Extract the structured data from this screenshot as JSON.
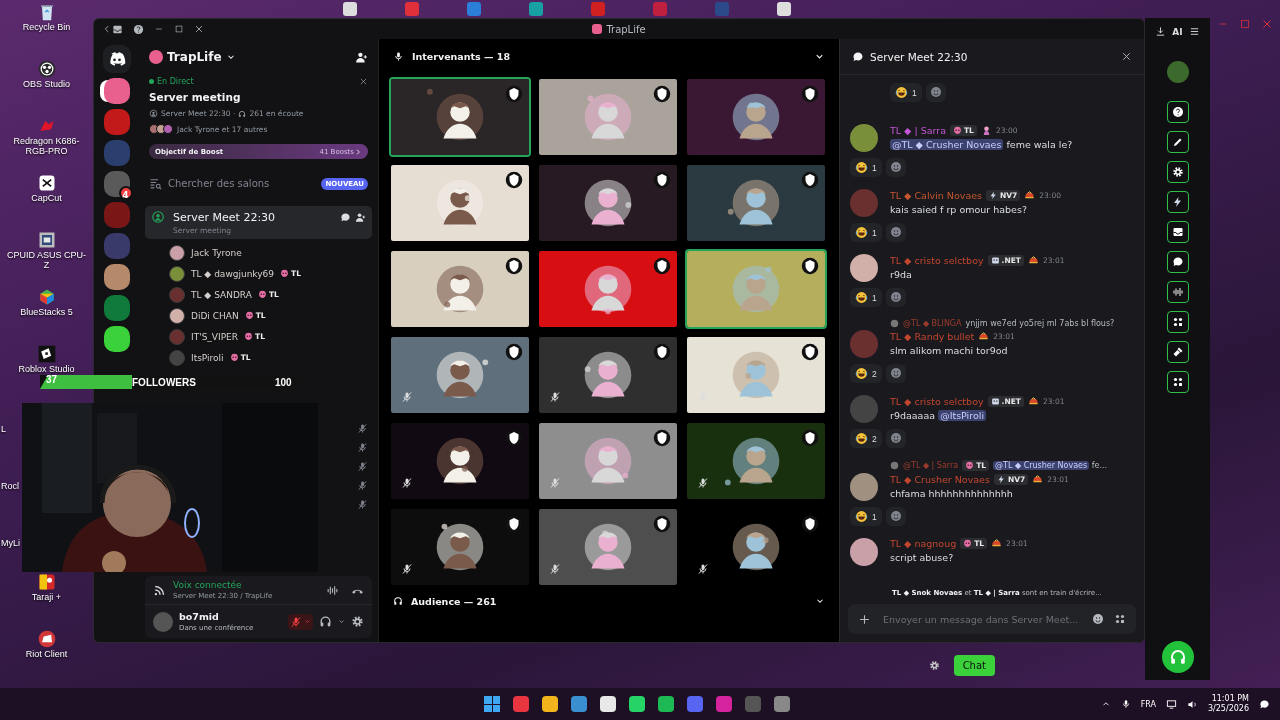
{
  "desktop_icons": [
    {
      "kind": "bin",
      "label": "Recycle Bin"
    },
    {
      "kind": "obs",
      "label": "OBS Studio"
    },
    {
      "kind": "redragon",
      "label": "Redragon K686-RGB-PRO"
    },
    {
      "kind": "capcut",
      "label": "CapCut"
    },
    {
      "kind": "cpuz",
      "label": "CPUID ASUS CPU-Z"
    },
    {
      "kind": "bluestacks",
      "label": "BlueStacks 5"
    },
    {
      "kind": "roblox",
      "label": "Roblox Studio"
    },
    {
      "kind": "hidden",
      "label": "L"
    },
    {
      "kind": "hidden",
      "label": "Rocl"
    },
    {
      "kind": "hidden",
      "label": "MyLi"
    },
    {
      "kind": "taraji",
      "label": "Taraji +"
    },
    {
      "kind": "riot",
      "label": "Riot Client"
    }
  ],
  "window": {
    "title": "TrapLife"
  },
  "servers": [
    {
      "color": "#e9608f",
      "selected": true
    },
    {
      "color": "#c21a1a",
      "selected": false
    },
    {
      "color": "#2b3f6e",
      "selected": false
    },
    {
      "color": "#5a5a5a",
      "selected": false,
      "badge": "4"
    },
    {
      "color": "#7a1616",
      "selected": false
    },
    {
      "color": "#3a3a6a",
      "selected": false
    },
    {
      "color": "#b58a6a",
      "selected": false
    },
    {
      "color": "#0f7a3a",
      "selected": false
    },
    {
      "color": "#3ad13a",
      "selected": false
    }
  ],
  "server": {
    "name": "TrapLife"
  },
  "event": {
    "status": "En Direct",
    "title": "Server meeting",
    "channel": "Server Meet 22:30 ·",
    "listeners": "261 en écoute",
    "attendees": "Jack Tyrone et 17 autres"
  },
  "boost": {
    "label": "Objectif de Boost",
    "count": "41 Boosts"
  },
  "channel_search": {
    "placeholder": "Chercher des salons",
    "badge": "NOUVEAU"
  },
  "voice_channel": {
    "name": "Server Meet 22:30",
    "topic": "Server meeting",
    "selected": true
  },
  "members": [
    {
      "name": "Jack Tyrone"
    },
    {
      "name": "TL ◆ dawgjunky69",
      "tag": "TL"
    },
    {
      "name": "TL ◆ SANDRA",
      "tag": "TL"
    },
    {
      "name": "DiDi CHAN",
      "tag": "TL"
    },
    {
      "name": "IT'S_VIPER",
      "tag": "TL"
    },
    {
      "name": "ItsPiroli",
      "tag": "TL"
    }
  ],
  "muted_members": [
    {
      "muted": true
    },
    {
      "muted": true
    },
    {
      "muted": true
    },
    {
      "muted": true
    },
    {
      "muted": true
    }
  ],
  "voice_status": {
    "status": "Voix connectée",
    "location": "Server Meet 22:30 / TrapLife"
  },
  "user": {
    "name": "bo7mid",
    "activity": "Dans une conférence",
    "mic_muted": true
  },
  "stage": {
    "speakers_header": "Intervenants — 18",
    "audience_header": "Audience — 261",
    "tiles": [
      {
        "color": "#2a2627",
        "speaking": true,
        "muted": false
      },
      {
        "color": "#a9a39c",
        "speaking": false,
        "muted": false
      },
      {
        "color": "#3a1733",
        "speaking": false,
        "muted": false
      },
      {
        "color": "#e6ddd3",
        "speaking": false,
        "muted": false
      },
      {
        "color": "#271a22",
        "speaking": false,
        "muted": false
      },
      {
        "color": "#2a3a40",
        "speaking": false,
        "muted": false
      },
      {
        "color": "#d8cfbf",
        "speaking": false,
        "muted": false
      },
      {
        "color": "#d80f12",
        "speaking": false,
        "muted": false
      },
      {
        "color": "#b5ae5c",
        "speaking": true,
        "muted": false
      },
      {
        "color": "#5f6f7c",
        "speaking": false,
        "muted": true
      },
      {
        "color": "#2f2f2f",
        "speaking": false,
        "muted": true
      },
      {
        "color": "#e6e2d6",
        "speaking": false,
        "muted": true
      },
      {
        "color": "#120a12",
        "speaking": false,
        "muted": true
      },
      {
        "color": "#8e8e8e",
        "speaking": false,
        "muted": true
      },
      {
        "color": "#19300f",
        "speaking": false,
        "muted": true
      },
      {
        "color": "#0d0d0d",
        "speaking": false,
        "muted": true
      },
      {
        "color": "#4e4e4e",
        "speaking": false,
        "muted": true
      },
      {
        "color": "#000000",
        "speaking": false,
        "muted": true
      }
    ]
  },
  "chat": {
    "title": "Server Meet 22:30",
    "messages": [
      {
        "kind": "reactions",
        "reaction": "1"
      },
      {
        "kind": "message",
        "author": "TL ◆ | Sarra",
        "color": "#c455d6",
        "badge": {
          "kind": "skull",
          "label": "TL"
        },
        "flair": {
          "kind": "girl"
        },
        "time": "23:00",
        "body": [
          {
            "kind": "mention",
            "text": "@TL ◆ Crusher Novaes"
          },
          {
            "kind": "text",
            "text": "feme wala le?"
          }
        ],
        "reaction": "1"
      },
      {
        "kind": "message",
        "author": "TL ◆ Calvin Novaes",
        "color": "#c4552e",
        "badge": {
          "kind": "bolt",
          "label": "NV7"
        },
        "flair": {
          "kind": "helmet"
        },
        "time": "23:00",
        "body": [
          {
            "kind": "text",
            "text": "kais saied f rp omour habes?"
          }
        ],
        "reaction": "1"
      },
      {
        "kind": "message",
        "author": "TL ◆ cristo selctboy",
        "color": "#c4452e",
        "badge": {
          "kind": "bot",
          "label": ".NET"
        },
        "flair": {
          "kind": "helmet"
        },
        "time": "23:01",
        "body": [
          {
            "kind": "text",
            "text": "r9da"
          }
        ],
        "reaction": "1"
      },
      {
        "kind": "message",
        "reply": {
          "author": "@TL ◆ BLINGA",
          "body": [
            {
              "kind": "text",
              "text": "ynjjm we7ed yo5rej ml 7abs bl flous?"
            }
          ]
        },
        "author": "TL ◆ Randy bullet",
        "color": "#c4452e",
        "flair": {
          "kind": "helmet"
        },
        "time": "23:01",
        "body": [
          {
            "kind": "text",
            "text": "slm alikom machi tor9od"
          }
        ],
        "reaction": "2"
      },
      {
        "kind": "message",
        "author": "TL ◆ cristo selctboy",
        "color": "#c4452e",
        "badge": {
          "kind": "bot",
          "label": ".NET"
        },
        "flair": {
          "kind": "helmet"
        },
        "time": "23:01",
        "body": [
          {
            "kind": "text",
            "text": "r9daaaaa"
          },
          {
            "kind": "mention",
            "text": "@ItsPiroli"
          }
        ],
        "reaction": "2"
      },
      {
        "kind": "message",
        "reply": {
          "author": "@TL ◆ | Sarra",
          "badge": {
            "kind": "skull",
            "label": "TL"
          },
          "body": [
            {
              "kind": "mention",
              "text": "@TL ◆ Crusher Novaes"
            },
            {
              "kind": "text",
              "text": "fe..."
            }
          ]
        },
        "author": "TL ◆ Crusher Novaes",
        "color": "#c4452e",
        "badge": {
          "kind": "bolt",
          "label": "NV7"
        },
        "flair": {
          "kind": "helmet"
        },
        "time": "23:01",
        "body": [
          {
            "kind": "text",
            "text": "chfama hhhhhhhhhhhhhh"
          }
        ],
        "reaction": "1"
      },
      {
        "kind": "message",
        "author": "TL ◆ nagnoug",
        "color": "#c4452e",
        "badge": {
          "kind": "skull",
          "label": "TL"
        },
        "flair": {
          "kind": "helmet"
        },
        "time": "23:01",
        "body": [
          {
            "kind": "text",
            "text": "script abuse?"
          }
        ]
      }
    ],
    "typing": "**TL ◆ Snok Novaes** et **TL ◆ | Sarra** sont en train d'écrire...",
    "input_placeholder": "Envoyer un message dans Server Meet..."
  },
  "followers": {
    "count": "37",
    "label": "FOLLOWERS",
    "goal": "100",
    "level": 0.33
  },
  "side_panel": {
    "label": "AI"
  },
  "chat_button": {
    "label": "Chat"
  },
  "tray": {
    "language": "FRA",
    "time": "11:01 PM",
    "date": "3/25/2026"
  }
}
